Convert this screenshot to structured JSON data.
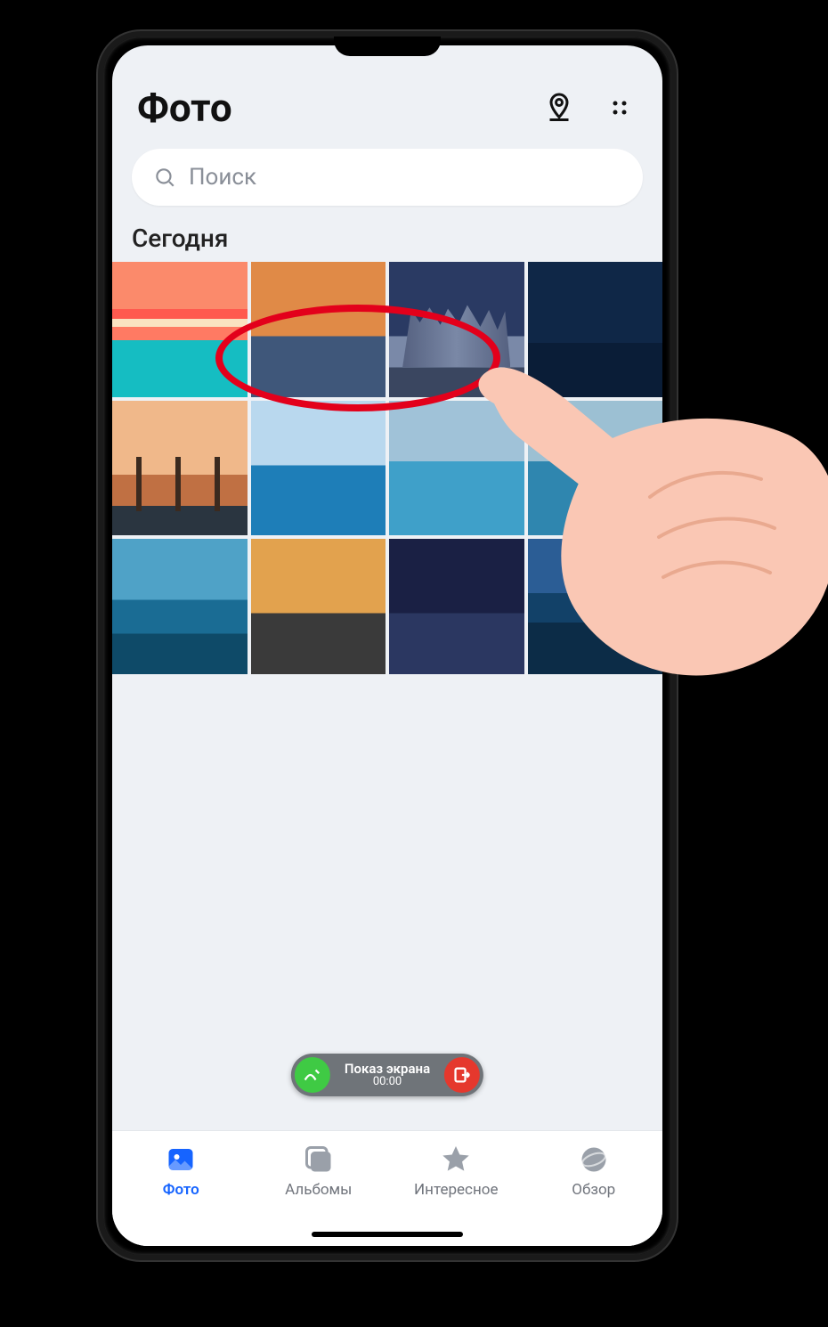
{
  "header": {
    "title": "Фото"
  },
  "search": {
    "placeholder": "Поиск"
  },
  "section": {
    "today": "Сегодня"
  },
  "pill": {
    "label": "Показ экрана",
    "time": "00:00"
  },
  "nav": {
    "photos": "Фото",
    "albums": "Альбомы",
    "featured": "Интересное",
    "browse": "Обзор"
  }
}
